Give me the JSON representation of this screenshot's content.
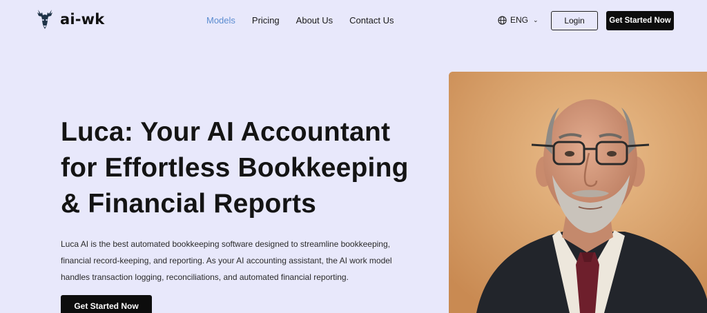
{
  "brand": {
    "name": "ai-wk",
    "logo_icon": "deer-head-icon"
  },
  "nav": {
    "items": [
      {
        "label": "Models",
        "active": true
      },
      {
        "label": "Pricing",
        "active": false
      },
      {
        "label": "About Us",
        "active": false
      },
      {
        "label": "Contact Us",
        "active": false
      }
    ]
  },
  "language": {
    "label": "ENG",
    "icon": "globe-icon"
  },
  "header": {
    "login_label": "Login",
    "cta_label": "Get Started Now"
  },
  "hero": {
    "title_lines": [
      "Luca: Your AI Accountant",
      "for Effortless Bookkeeping",
      "& Financial Reports"
    ],
    "description_lines": [
      "Luca AI is the best automated bookkeeping software designed to streamline bookkeeping,",
      "financial record-keeping, and reporting. As your AI accounting assistant, the AI work model",
      "handles transaction logging, reconciliations, and automated financial reporting."
    ],
    "cta_label": "Get Started Now"
  },
  "colors": {
    "background": "#e8e8fb",
    "accent_nav": "#5b8cd0",
    "button_dark": "#0d0d0d",
    "portrait_bg": "#d59c64"
  }
}
